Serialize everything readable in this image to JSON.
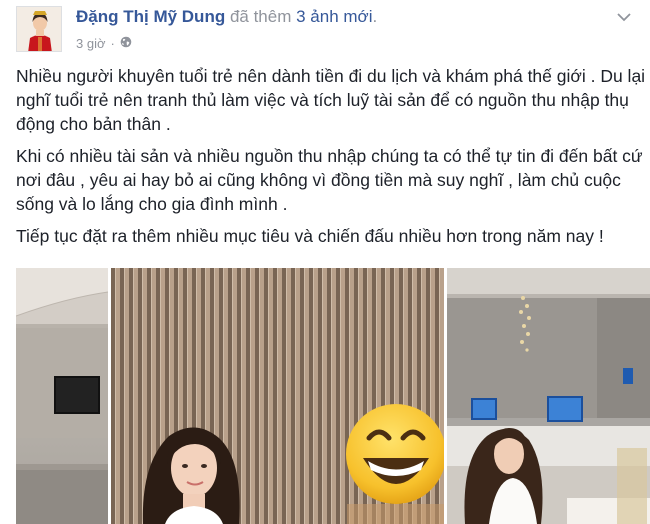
{
  "post": {
    "author": "Đặng Thị Mỹ Dung",
    "action": "đã thêm",
    "photos_link": "3 ảnh mới",
    "period": ".",
    "time": "3 giờ",
    "separator": "·",
    "privacy_icon": "globe-icon",
    "menu_icon": "chevron-down-icon",
    "paragraphs": [
      "Nhiều người khuyên tuổi trẻ nên dành tiền đi du lịch và khám phá thế giới . Du lại nghĩ tuổi trẻ nên tranh thủ làm việc và tích luỹ tài sản để có nguồn thu nhập thụ động cho bản thân .",
      "Khi có nhiều tài sản và nhiều nguồn thu nhập chúng ta có thể tự tin đi đến bất cứ nơi đâu , yêu ai hay bỏ ai cũng không vì đồng tiền mà suy nghĩ , làm chủ cuộc sống và lo lắng cho gia đình mình .",
      "Tiếp tục đặt ra thêm nhiều mục tiêu và chiến đấu nhiều hơn trong năm nay !"
    ],
    "photo_count": 3
  },
  "colors": {
    "link": "#365899",
    "meta": "#90949c",
    "text": "#1d2129"
  }
}
